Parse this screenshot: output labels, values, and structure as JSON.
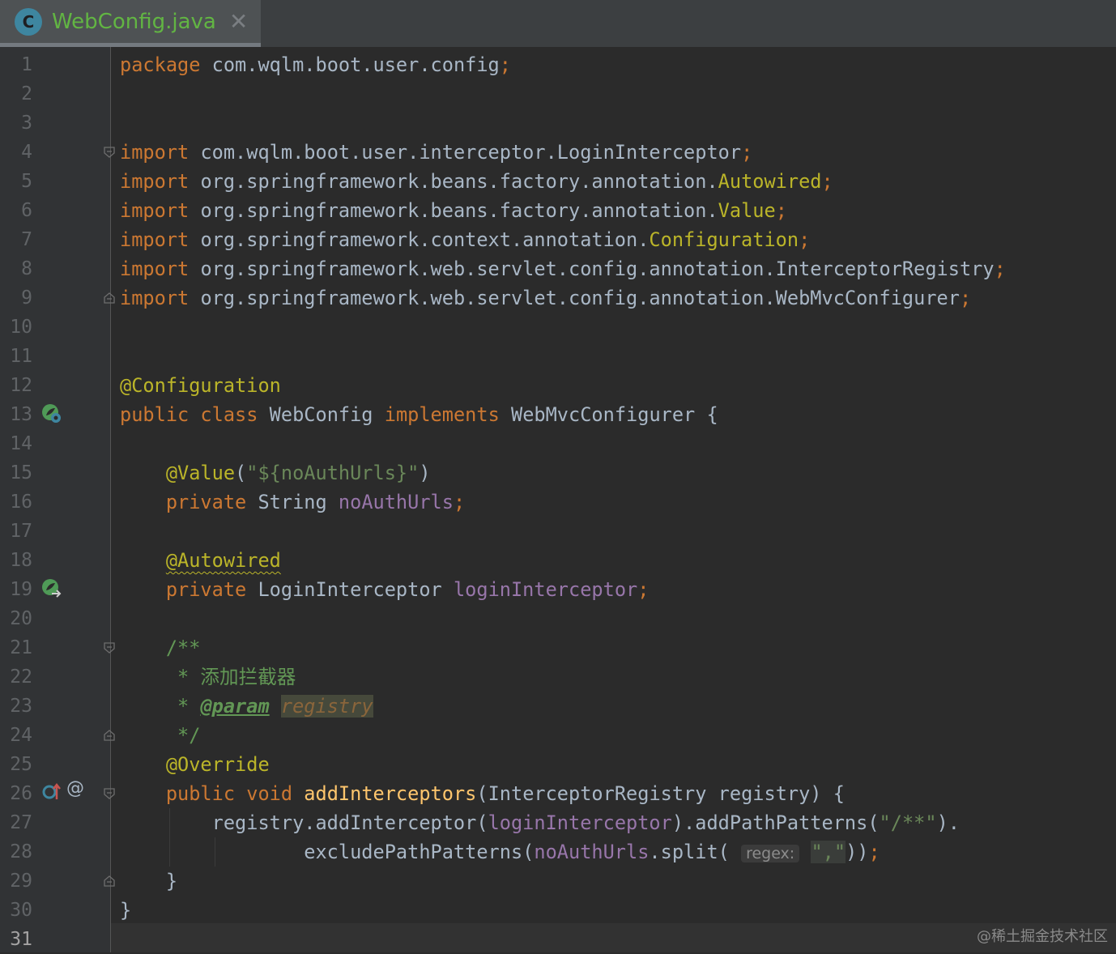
{
  "tab": {
    "icon_letter": "C",
    "filename": "WebConfig.java",
    "close_glyph": "✕"
  },
  "line_numbers": [
    "1",
    "2",
    "3",
    "4",
    "5",
    "6",
    "7",
    "8",
    "9",
    "10",
    "11",
    "12",
    "13",
    "14",
    "15",
    "16",
    "17",
    "18",
    "19",
    "20",
    "21",
    "22",
    "23",
    "24",
    "25",
    "26",
    "27",
    "28",
    "29",
    "30",
    "31"
  ],
  "current_line": "31",
  "code": {
    "l1": [
      "package",
      " com.wqlm.boot.user.config",
      ";"
    ],
    "l4": [
      "import",
      " com.wqlm.boot.user.interceptor.LoginInterceptor",
      ";"
    ],
    "l5": [
      "import",
      " org.springframework.beans.factory.annotation.",
      "Autowired",
      ";"
    ],
    "l6": [
      "import",
      " org.springframework.beans.factory.annotation.",
      "Value",
      ";"
    ],
    "l7": [
      "import",
      " org.springframework.context.annotation.",
      "Configuration",
      ";"
    ],
    "l8": [
      "import",
      " org.springframework.web.servlet.config.annotation.InterceptorRegistry",
      ";"
    ],
    "l9": [
      "import",
      " org.springframework.web.servlet.config.annotation.WebMvcConfigurer",
      ";"
    ],
    "l12": [
      "@Configuration"
    ],
    "l13": [
      "public class",
      " WebConfig ",
      "implements",
      " WebMvcConfigurer {"
    ],
    "l15": [
      "    @Value",
      "(",
      "\"${noAuthUrls}\"",
      ")"
    ],
    "l16": [
      "    private",
      " String ",
      "noAuthUrls",
      ";"
    ],
    "l18": [
      "    ",
      "@Autowired"
    ],
    "l19": [
      "    private",
      " LoginInterceptor ",
      "loginInterceptor",
      ";"
    ],
    "l21": [
      "    /**"
    ],
    "l22": [
      "     * 添加拦截器"
    ],
    "l23": [
      "     * ",
      "@param",
      " ",
      "registry"
    ],
    "l24": [
      "     */"
    ],
    "l25": [
      "    @Override"
    ],
    "l26": [
      "    public void",
      " ",
      "addInterceptors",
      "(InterceptorRegistry registry) {"
    ],
    "l27": [
      "        registry.addInterceptor(",
      "loginInterceptor",
      ").addPathPatterns(",
      "\"/**\"",
      ")."
    ],
    "l28": [
      "                excludePathPatterns(",
      "noAuthUrls",
      ".split( ",
      "regex:",
      " ",
      "\",\"",
      "))",
      ";"
    ],
    "l29": [
      "    }"
    ],
    "l30": [
      "}"
    ]
  },
  "gutter_icons": {
    "line13": "bean-implements-icon",
    "line19": "bean-autowired-icon",
    "line26_override": "override-method-icon",
    "line26_at": "@"
  },
  "watermark": "@稀土掘金技术社区",
  "colors": {
    "keyword": "#cc7832",
    "annotation": "#bbb529",
    "field": "#9876aa",
    "string": "#6a8759",
    "doc": "#629755",
    "method": "#ffc66d",
    "plain": "#a9b7c6",
    "background": "#2b2b2b"
  }
}
